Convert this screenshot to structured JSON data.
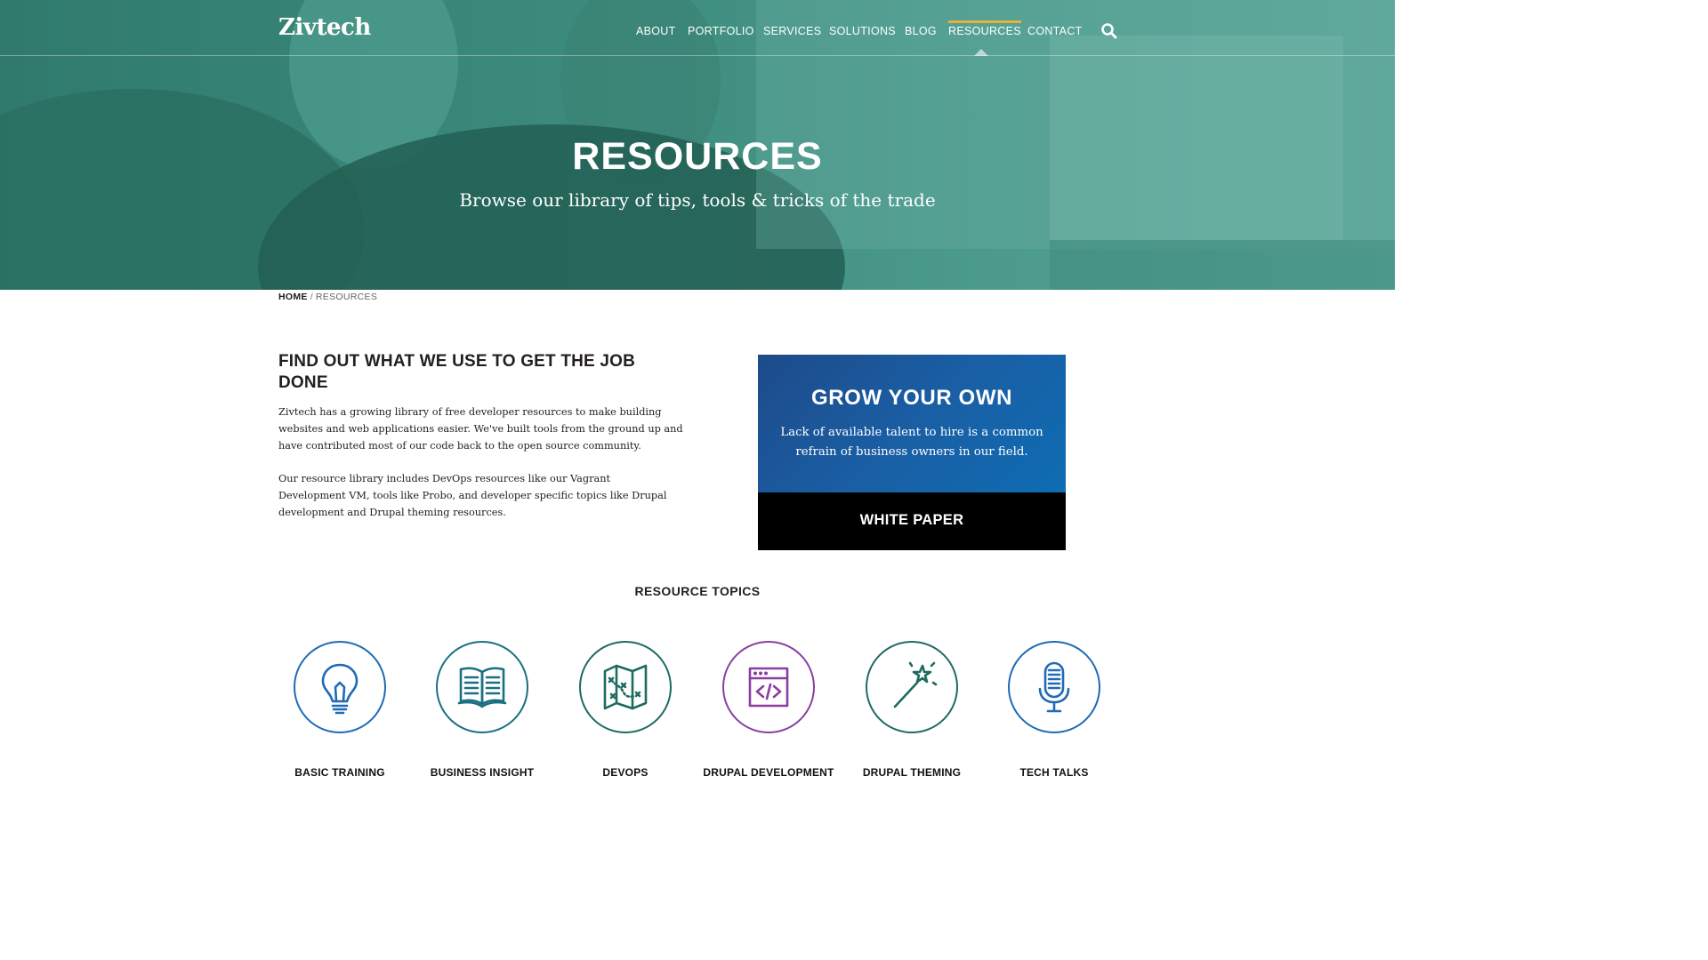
{
  "brand": {
    "name": "Zivtech",
    "dot_color": "#e9a23b"
  },
  "nav": {
    "items": [
      {
        "label": "ABOUT"
      },
      {
        "label": "PORTFOLIO"
      },
      {
        "label": "SERVICES"
      },
      {
        "label": "SOLUTIONS"
      },
      {
        "label": "BLOG"
      },
      {
        "label": "RESOURCES",
        "active": true
      },
      {
        "label": "CONTACT"
      }
    ],
    "search_icon": "search-icon",
    "active_color": "#e9b13b"
  },
  "hero": {
    "title": "RESOURCES",
    "subtitle": "Browse our library of tips, tools & tricks of the trade",
    "tint_color": "#3f8e80"
  },
  "breadcrumb": {
    "home": "HOME",
    "separator": "/",
    "current": "RESOURCES"
  },
  "intro": {
    "heading": "FIND OUT WHAT WE USE TO GET THE JOB DONE",
    "paragraph1": "Zivtech has a growing library of free developer resources to make building websites and web applications easier. We've built tools from the ground up and have contributed most of our code back to the open source community.",
    "paragraph2": "Our resource library includes DevOps resources like our Vagrant Development VM, tools like Probo, and developer specific topics like Drupal development and Drupal theming resources."
  },
  "promo": {
    "title": "GROW YOUR OWN",
    "text": "Lack of available talent to hire is a common refrain of business owners in our field.",
    "cta": "WHITE PAPER",
    "gradient_colors": [
      "#1d4b8a",
      "#0e6db3"
    ]
  },
  "topics": {
    "heading": "RESOURCE TOPICS",
    "items": [
      {
        "label": "BASIC TRAINING",
        "icon": "lightbulb-icon",
        "color": "#1f6bb5"
      },
      {
        "label": "BUSINESS INSIGHT",
        "icon": "book-icon",
        "color": "#1a7080"
      },
      {
        "label": "DEVOPS",
        "icon": "map-icon",
        "color": "#1e6b5f"
      },
      {
        "label": "DRUPAL DEVELOPMENT",
        "icon": "code-window-icon",
        "color": "#8a3fa0"
      },
      {
        "label": "DRUPAL THEMING",
        "icon": "magic-wand-icon",
        "color": "#1e6b5f"
      },
      {
        "label": "TECH TALKS",
        "icon": "microphone-icon",
        "color": "#1f6bb5"
      }
    ]
  }
}
